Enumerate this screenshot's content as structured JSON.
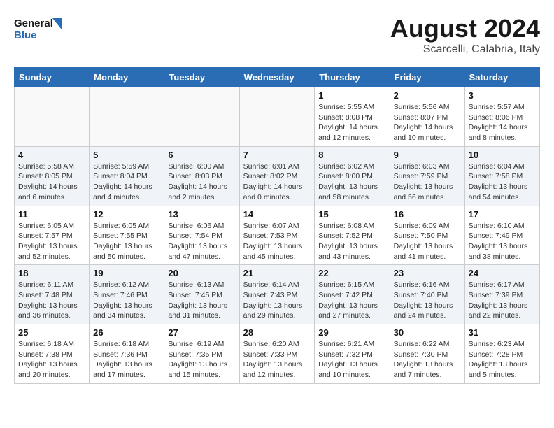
{
  "header": {
    "logo_general": "General",
    "logo_blue": "Blue",
    "title": "August 2024",
    "subtitle": "Scarcelli, Calabria, Italy"
  },
  "days_of_week": [
    "Sunday",
    "Monday",
    "Tuesday",
    "Wednesday",
    "Thursday",
    "Friday",
    "Saturday"
  ],
  "weeks": [
    [
      {
        "day": "",
        "info": ""
      },
      {
        "day": "",
        "info": ""
      },
      {
        "day": "",
        "info": ""
      },
      {
        "day": "",
        "info": ""
      },
      {
        "day": "1",
        "info": "Sunrise: 5:55 AM\nSunset: 8:08 PM\nDaylight: 14 hours\nand 12 minutes."
      },
      {
        "day": "2",
        "info": "Sunrise: 5:56 AM\nSunset: 8:07 PM\nDaylight: 14 hours\nand 10 minutes."
      },
      {
        "day": "3",
        "info": "Sunrise: 5:57 AM\nSunset: 8:06 PM\nDaylight: 14 hours\nand 8 minutes."
      }
    ],
    [
      {
        "day": "4",
        "info": "Sunrise: 5:58 AM\nSunset: 8:05 PM\nDaylight: 14 hours\nand 6 minutes."
      },
      {
        "day": "5",
        "info": "Sunrise: 5:59 AM\nSunset: 8:04 PM\nDaylight: 14 hours\nand 4 minutes."
      },
      {
        "day": "6",
        "info": "Sunrise: 6:00 AM\nSunset: 8:03 PM\nDaylight: 14 hours\nand 2 minutes."
      },
      {
        "day": "7",
        "info": "Sunrise: 6:01 AM\nSunset: 8:02 PM\nDaylight: 14 hours\nand 0 minutes."
      },
      {
        "day": "8",
        "info": "Sunrise: 6:02 AM\nSunset: 8:00 PM\nDaylight: 13 hours\nand 58 minutes."
      },
      {
        "day": "9",
        "info": "Sunrise: 6:03 AM\nSunset: 7:59 PM\nDaylight: 13 hours\nand 56 minutes."
      },
      {
        "day": "10",
        "info": "Sunrise: 6:04 AM\nSunset: 7:58 PM\nDaylight: 13 hours\nand 54 minutes."
      }
    ],
    [
      {
        "day": "11",
        "info": "Sunrise: 6:05 AM\nSunset: 7:57 PM\nDaylight: 13 hours\nand 52 minutes."
      },
      {
        "day": "12",
        "info": "Sunrise: 6:05 AM\nSunset: 7:55 PM\nDaylight: 13 hours\nand 50 minutes."
      },
      {
        "day": "13",
        "info": "Sunrise: 6:06 AM\nSunset: 7:54 PM\nDaylight: 13 hours\nand 47 minutes."
      },
      {
        "day": "14",
        "info": "Sunrise: 6:07 AM\nSunset: 7:53 PM\nDaylight: 13 hours\nand 45 minutes."
      },
      {
        "day": "15",
        "info": "Sunrise: 6:08 AM\nSunset: 7:52 PM\nDaylight: 13 hours\nand 43 minutes."
      },
      {
        "day": "16",
        "info": "Sunrise: 6:09 AM\nSunset: 7:50 PM\nDaylight: 13 hours\nand 41 minutes."
      },
      {
        "day": "17",
        "info": "Sunrise: 6:10 AM\nSunset: 7:49 PM\nDaylight: 13 hours\nand 38 minutes."
      }
    ],
    [
      {
        "day": "18",
        "info": "Sunrise: 6:11 AM\nSunset: 7:48 PM\nDaylight: 13 hours\nand 36 minutes."
      },
      {
        "day": "19",
        "info": "Sunrise: 6:12 AM\nSunset: 7:46 PM\nDaylight: 13 hours\nand 34 minutes."
      },
      {
        "day": "20",
        "info": "Sunrise: 6:13 AM\nSunset: 7:45 PM\nDaylight: 13 hours\nand 31 minutes."
      },
      {
        "day": "21",
        "info": "Sunrise: 6:14 AM\nSunset: 7:43 PM\nDaylight: 13 hours\nand 29 minutes."
      },
      {
        "day": "22",
        "info": "Sunrise: 6:15 AM\nSunset: 7:42 PM\nDaylight: 13 hours\nand 27 minutes."
      },
      {
        "day": "23",
        "info": "Sunrise: 6:16 AM\nSunset: 7:40 PM\nDaylight: 13 hours\nand 24 minutes."
      },
      {
        "day": "24",
        "info": "Sunrise: 6:17 AM\nSunset: 7:39 PM\nDaylight: 13 hours\nand 22 minutes."
      }
    ],
    [
      {
        "day": "25",
        "info": "Sunrise: 6:18 AM\nSunset: 7:38 PM\nDaylight: 13 hours\nand 20 minutes."
      },
      {
        "day": "26",
        "info": "Sunrise: 6:18 AM\nSunset: 7:36 PM\nDaylight: 13 hours\nand 17 minutes."
      },
      {
        "day": "27",
        "info": "Sunrise: 6:19 AM\nSunset: 7:35 PM\nDaylight: 13 hours\nand 15 minutes."
      },
      {
        "day": "28",
        "info": "Sunrise: 6:20 AM\nSunset: 7:33 PM\nDaylight: 13 hours\nand 12 minutes."
      },
      {
        "day": "29",
        "info": "Sunrise: 6:21 AM\nSunset: 7:32 PM\nDaylight: 13 hours\nand 10 minutes."
      },
      {
        "day": "30",
        "info": "Sunrise: 6:22 AM\nSunset: 7:30 PM\nDaylight: 13 hours\nand 7 minutes."
      },
      {
        "day": "31",
        "info": "Sunrise: 6:23 AM\nSunset: 7:28 PM\nDaylight: 13 hours\nand 5 minutes."
      }
    ]
  ]
}
